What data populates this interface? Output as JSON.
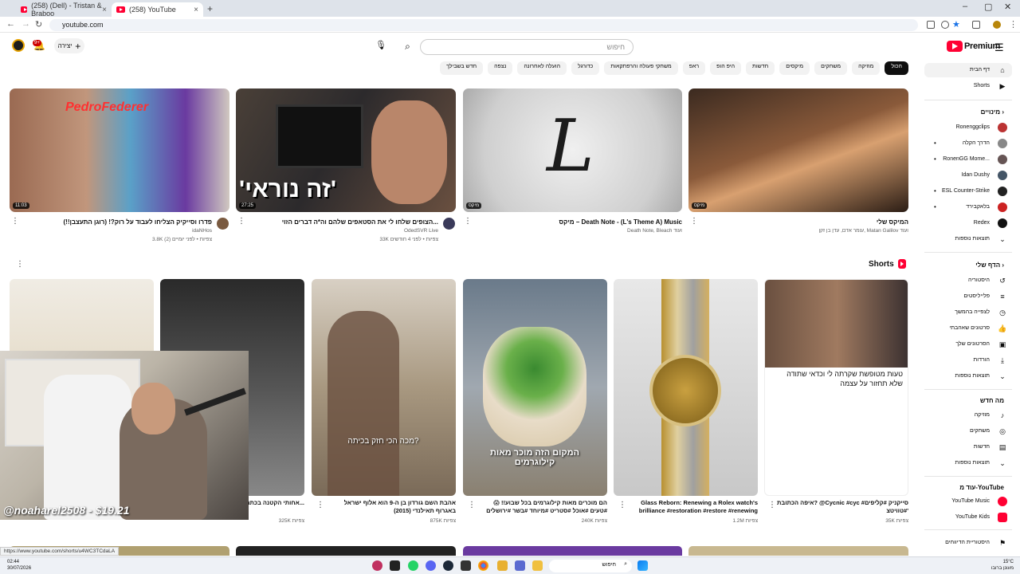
{
  "browser": {
    "tabs": [
      {
        "label": "(258) (Dell) - Tristan & Braboo",
        "active": false
      },
      {
        "label": "(258) YouTube",
        "active": true
      }
    ],
    "url": "youtube.com",
    "status_url": "https://www.youtube.com/shorts/u4WC3TCdaLA"
  },
  "header": {
    "logo_text": "Premium",
    "search_placeholder": "חיפוש",
    "create_label": "יצירה",
    "notif_count": "9+"
  },
  "chips": [
    "הכול",
    "מוזיקה",
    "משחקים",
    "מיקסים",
    "חדשות",
    "היפ הופ",
    "ראפ",
    "משחקי פעולה והרפתקאות",
    "כדורגל",
    "הועלה לאחרונה",
    "נצפה",
    "חדש בשבילך"
  ],
  "videos": [
    {
      "title": "המיקס שלי",
      "channel": "עומר אדם, עדן בן זקן, Matan Galilov ועוד",
      "meta": "",
      "duration": "מיקס"
    },
    {
      "title": "מיקס – Death Note - (L's Theme A) Music",
      "channel": "Death Note, Bleach ועוד",
      "meta": "",
      "duration": "מיקס"
    },
    {
      "title": "הצופים שלחו לי את הסטאפים שלהם וה*ה דברים הזוי...",
      "channel": "OdedSVR Live",
      "meta": "33K צפיות • לפני 4 חודשים",
      "duration": "27:25"
    },
    {
      "title": "פדרו וסייקיק הצליחו לעבוד על רוק?! (רוגן התעצבן!!)",
      "channel": "idaNHos",
      "meta": "3.8K צפיות • לפני יומיים (2)",
      "duration": "11:03"
    }
  ],
  "shorts": {
    "label": "Shorts",
    "items": [
      {
        "title": "איפה הכתובת? @Cycnic #cyc #סייקניק #קליפים #טוויטצ'",
        "views": "35K צפיות",
        "overlay": "טעות מטופשת שקרתה לי וכדאי שתודה שלא תחזור על עצמה"
      },
      {
        "title": "Glass Reborn: Renewing a Rolex watch's brilliance #restoration #restore #renewing",
        "views": "1.2M צפיות",
        "overlay": ""
      },
      {
        "title": "הם מוכרים מאות קילוגרמים בכל שבוע!! 😱 #טעים #אוכל #סטריט #מיוחד #בשר #ירושלים #טוב ב...",
        "views": "240K צפיות",
        "overlay": "המקום הזה מוכר מאות קילוגרמים"
      },
      {
        "title": "אהבת השם גורדון בן ה-9 הוא אלוף ישראל באגרוף תאילנדי (2015)",
        "views": "875K צפיות",
        "overlay": "מכה הכי חזק בכיתה?"
      },
      {
        "title": "אחותי הקטנה בכתה בכת...",
        "views": "325K צפיות",
        "overlay": ""
      },
      {
        "title": "",
        "views": "",
        "overlay": ""
      }
    ]
  },
  "sidebar": {
    "top": [
      {
        "label": "דף הבית",
        "icon": "home-icon",
        "active": true
      },
      {
        "label": "Shorts",
        "icon": "shorts-icon",
        "active": false
      }
    ],
    "subs_title": "מינויים",
    "subs": [
      {
        "label": "Ronenggclips",
        "live": false,
        "color": "#b33"
      },
      {
        "label": "הדרך הקלה",
        "live": true,
        "color": "#888"
      },
      {
        "label": "RonenGG Mome...",
        "live": true,
        "color": "#655"
      },
      {
        "label": "Idan Dushy",
        "live": false,
        "color": "#456"
      },
      {
        "label": "ESL Counter-Strike",
        "live": true,
        "color": "#222"
      },
      {
        "label": "בלאקבירד",
        "live": true,
        "color": "#c22"
      },
      {
        "label": "Redex",
        "live": false,
        "color": "#111"
      },
      {
        "label": "תוצאות נוספות",
        "live": false,
        "color": ""
      }
    ],
    "you_title": "הדף שלי",
    "you": [
      {
        "label": "היסטוריה",
        "icon": "history-icon"
      },
      {
        "label": "פלייליסטים",
        "icon": "playlist-icon"
      },
      {
        "label": "לצפייה בהמשך",
        "icon": "clock-icon"
      },
      {
        "label": "סרטונים שאהבתי",
        "icon": "like-icon"
      },
      {
        "label": "הסרטונים שלך",
        "icon": "video-icon"
      },
      {
        "label": "הורדות",
        "icon": "download-icon"
      },
      {
        "label": "תוצאות נוספות",
        "icon": "chevron-down-icon"
      }
    ],
    "explore_title": "מה חדש",
    "explore": [
      {
        "label": "מוזיקה",
        "icon": "music-icon"
      },
      {
        "label": "משחקים",
        "icon": "gaming-icon"
      },
      {
        "label": "חדשות",
        "icon": "news-icon"
      },
      {
        "label": "תוצאות נוספות",
        "icon": "chevron-down-icon"
      }
    ],
    "more_title": "עוד מ-YouTube",
    "more": [
      {
        "label": "YouTube Music",
        "icon": "yt-music-icon"
      },
      {
        "label": "YouTube Kids",
        "icon": "yt-kids-icon"
      },
      {
        "label": "היסטוריית הדיווחים",
        "icon": "flag-icon"
      }
    ]
  },
  "overlay": {
    "handle": "@noaharel2508 - $19.21"
  },
  "taskbar": {
    "time": "02:44",
    "date": "30/07/2026",
    "search_label": "חיפוש",
    "weather": "15°C",
    "weather_text": "מעונן ברובו"
  },
  "colors": {
    "accent": "#ff0033",
    "chip_active": "#0f0f0f"
  }
}
